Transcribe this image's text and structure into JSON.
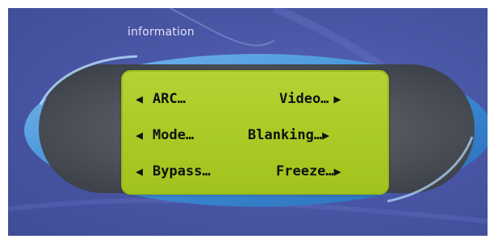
{
  "header": {
    "title": "information"
  },
  "menu": {
    "left_arrow": "◀",
    "right_arrow": "▶",
    "items": [
      {
        "label": "ARC…"
      },
      {
        "label": "Video…"
      },
      {
        "label": "Mode…"
      },
      {
        "label": "Blanking…"
      },
      {
        "label": "Bypass…"
      },
      {
        "label": "Freeze…"
      }
    ]
  },
  "colors": {
    "background": "#4a57a6",
    "lcd": "#aacb26",
    "ring": "#3a8fd8",
    "text": "#111111"
  }
}
